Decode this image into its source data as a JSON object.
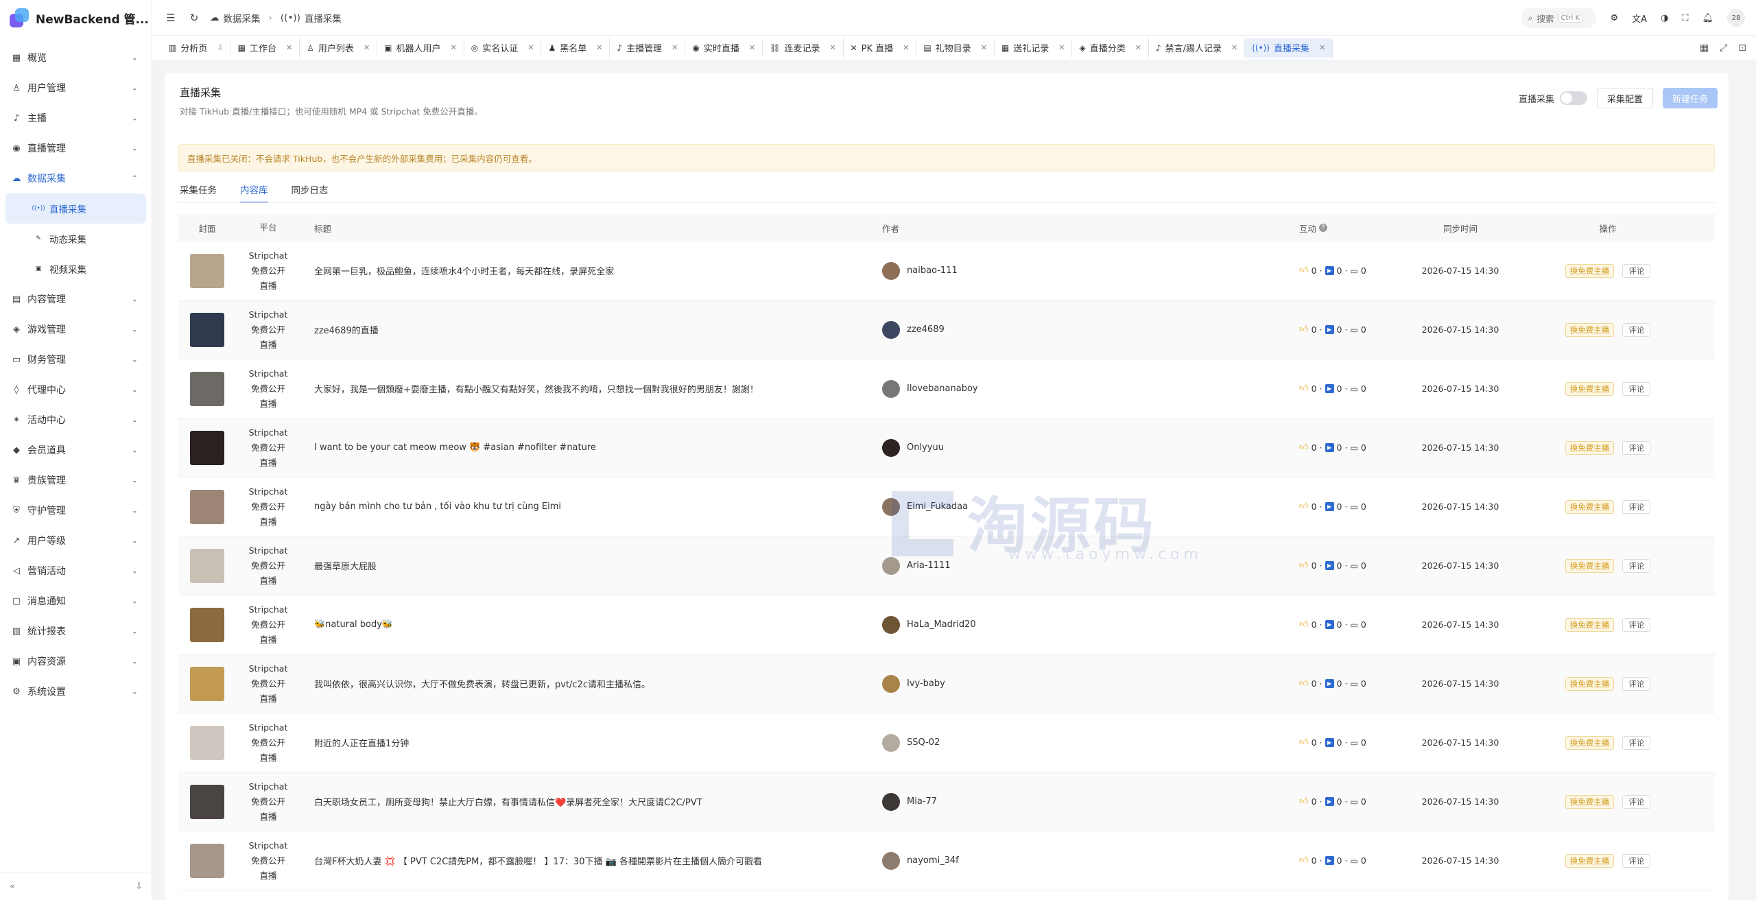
{
  "app": {
    "title": "NewBackend 管..."
  },
  "sidebar": {
    "items": [
      {
        "label": "概览",
        "icon": "grid-icon"
      },
      {
        "label": "用户管理",
        "icon": "user-icon"
      },
      {
        "label": "主播",
        "icon": "mic-icon"
      },
      {
        "label": "直播管理",
        "icon": "broadcast-icon"
      },
      {
        "label": "数据采集",
        "icon": "cloud-download-icon"
      },
      {
        "label": "内容管理",
        "icon": "content-icon"
      },
      {
        "label": "游戏管理",
        "icon": "gamepad-icon"
      },
      {
        "label": "财务管理",
        "icon": "wallet-icon"
      },
      {
        "label": "代理中心",
        "icon": "shield-icon"
      },
      {
        "label": "活动中心",
        "icon": "activity-icon"
      },
      {
        "label": "会员道具",
        "icon": "diamond-icon"
      },
      {
        "label": "贵族管理",
        "icon": "crown-icon"
      },
      {
        "label": "守护管理",
        "icon": "guard-icon"
      },
      {
        "label": "用户等级",
        "icon": "trend-icon"
      },
      {
        "label": "营销活动",
        "icon": "megaphone-icon"
      },
      {
        "label": "消息通知",
        "icon": "message-icon"
      },
      {
        "label": "统计报表",
        "icon": "chart-icon"
      },
      {
        "label": "内容资源",
        "icon": "resource-icon"
      },
      {
        "label": "系统设置",
        "icon": "gear-icon"
      }
    ],
    "sub_items": [
      {
        "label": "直播采集"
      },
      {
        "label": "动态采集"
      },
      {
        "label": "视频采集"
      }
    ]
  },
  "topbar": {
    "breadcrumb": [
      "数据采集",
      "直播采集"
    ],
    "search_label": "搜索",
    "search_kbd": "Ctrl K",
    "avatar_text": "28"
  },
  "tabs": [
    {
      "label": "分析页"
    },
    {
      "label": "工作台"
    },
    {
      "label": "用户列表"
    },
    {
      "label": "机器人用户"
    },
    {
      "label": "实名认证"
    },
    {
      "label": "黑名单"
    },
    {
      "label": "主播管理"
    },
    {
      "label": "实时直播"
    },
    {
      "label": "连麦记录"
    },
    {
      "label": "PK 直播"
    },
    {
      "label": "礼物目录"
    },
    {
      "label": "送礼记录"
    },
    {
      "label": "直播分类"
    },
    {
      "label": "禁言/踢人记录"
    },
    {
      "label": "直播采集"
    }
  ],
  "page": {
    "title": "直播采集",
    "description": "对接 TikHub 直播/主播接口；也可使用随机 MP4 或 Stripchat 免费公开直播。",
    "toggle_label": "直播采集",
    "config_button": "采集配置",
    "new_task_button": "新建任务",
    "alert": "直播采集已关闭：不会请求 TikHub，也不会产生新的外部采集费用；已采集内容仍可查看。",
    "subtabs": [
      "采集任务",
      "内容库",
      "同步日志"
    ]
  },
  "table": {
    "headers": {
      "cover": "封面",
      "platform": "平台",
      "title": "标题",
      "author": "作者",
      "interaction": "互动",
      "sync_time": "同步时间",
      "ops": "操作"
    },
    "rows": [
      {
        "p1": "Stripchat",
        "p2": "免费公开",
        "p3": "直播",
        "title": "全网第一巨乳，极品鲍鱼，连续喷水4个小时王者，每天都在线，录屏死全家",
        "author": "naibao-111",
        "likes": "0",
        "plays": "0",
        "comments": "0",
        "time": "2026-07-15 14:30",
        "op1": "换免费主播",
        "op2": "评论",
        "thumb": "#b9a48e",
        "av": "#8d6e57"
      },
      {
        "p1": "Stripchat",
        "p2": "免费公开",
        "p3": "直播",
        "title": "zze4689的直播",
        "author": "zze4689",
        "likes": "0",
        "plays": "0",
        "comments": "0",
        "time": "2026-07-15 14:30",
        "op1": "换免费主播",
        "op2": "评论",
        "thumb": "#2f3a4f",
        "av": "#3c4660"
      },
      {
        "p1": "Stripchat",
        "p2": "免费公开",
        "p3": "直播",
        "title": "大家好，我是一個頹廢+耍廢主播，有點小醜又有點好笑，然後我不約唷，只想找一個對我很好的男朋友！謝謝！",
        "author": "Ilovebananaboy",
        "likes": "0",
        "plays": "0",
        "comments": "0",
        "time": "2026-07-15 14:30",
        "op1": "换免费主播",
        "op2": "评论",
        "thumb": "#6d6a66",
        "av": "#777"
      },
      {
        "p1": "Stripchat",
        "p2": "免费公开",
        "p3": "直播",
        "title": "I want to be your cat meow meow 🐯 #asian #nofilter #nature",
        "author": "Onlyyuu",
        "likes": "0",
        "plays": "0",
        "comments": "0",
        "time": "2026-07-15 14:30",
        "op1": "换免费主播",
        "op2": "评论",
        "thumb": "#2a2220",
        "av": "#2b2421"
      },
      {
        "p1": "Stripchat",
        "p2": "免费公开",
        "p3": "直播",
        "title": "ngày bán mình cho tư bản , tối vào khu tự trị cùng Eimi",
        "author": "Eimi_Fukadaa",
        "likes": "0",
        "plays": "0",
        "comments": "0",
        "time": "2026-07-15 14:30",
        "op1": "换免费主播",
        "op2": "评论",
        "thumb": "#9e8676",
        "av": "#8a7363"
      },
      {
        "p1": "Stripchat",
        "p2": "免费公开",
        "p3": "直播",
        "title": "最强草原大屁股",
        "author": "Aria-1111",
        "likes": "0",
        "plays": "0",
        "comments": "0",
        "time": "2026-07-15 14:30",
        "op1": "换免费主播",
        "op2": "评论",
        "thumb": "#c9c1b6",
        "av": "#a3998c"
      },
      {
        "p1": "Stripchat",
        "p2": "免费公开",
        "p3": "直播",
        "title": "🐝natural body🐝",
        "author": "HaLa_Madrid20",
        "likes": "0",
        "plays": "0",
        "comments": "0",
        "time": "2026-07-15 14:30",
        "op1": "换免费主播",
        "op2": "评论",
        "thumb": "#8a6a3e",
        "av": "#6e5534"
      },
      {
        "p1": "Stripchat",
        "p2": "免费公开",
        "p3": "直播",
        "title": "我叫依依，很高兴认识你，大厅不做免费表演，转盘已更新，pvt/c2c请和主播私信。",
        "author": "Ivy-baby",
        "likes": "0",
        "plays": "0",
        "comments": "0",
        "time": "2026-07-15 14:30",
        "op1": "换免费主播",
        "op2": "评论",
        "thumb": "#c29a52",
        "av": "#a9844a"
      },
      {
        "p1": "Stripchat",
        "p2": "免费公开",
        "p3": "直播",
        "title": "附近的人正在直播1分钟",
        "author": "SSQ-02",
        "likes": "0",
        "plays": "0",
        "comments": "0",
        "time": "2026-07-15 14:30",
        "op1": "换免费主播",
        "op2": "评论",
        "thumb": "#cfc8c0",
        "av": "#b4aba0"
      },
      {
        "p1": "Stripchat",
        "p2": "免费公开",
        "p3": "直播",
        "title": "白天职场女员工，厕所变母狗！禁止大厅白嫖，有事情请私信❤️录屏者死全家！大尺度请C2C/PVT",
        "author": "Mia-77",
        "likes": "0",
        "plays": "0",
        "comments": "0",
        "time": "2026-07-15 14:30",
        "op1": "换免费主播",
        "op2": "评论",
        "thumb": "#4a4542",
        "av": "#3d3836"
      },
      {
        "p1": "Stripchat",
        "p2": "免费公开",
        "p3": "直播",
        "title": "台灣F杯大奶人妻 💢 【 PVT C2C請先PM，都不露臉喔！ 】17：30下播 📷 各種開票影片在主播個人簡介可觀看",
        "author": "nayomi_34f",
        "likes": "0",
        "plays": "0",
        "comments": "0",
        "time": "2026-07-15 14:30",
        "op1": "换免费主播",
        "op2": "评论",
        "thumb": "#a7978a",
        "av": "#8c7c70"
      }
    ]
  },
  "watermark": {
    "text": "淘源码",
    "url": "www.taoymw.com"
  },
  "colors": {
    "primary": "#2c69d1",
    "warning_bg": "#fdf6e4",
    "warning_text": "#b8862b"
  }
}
